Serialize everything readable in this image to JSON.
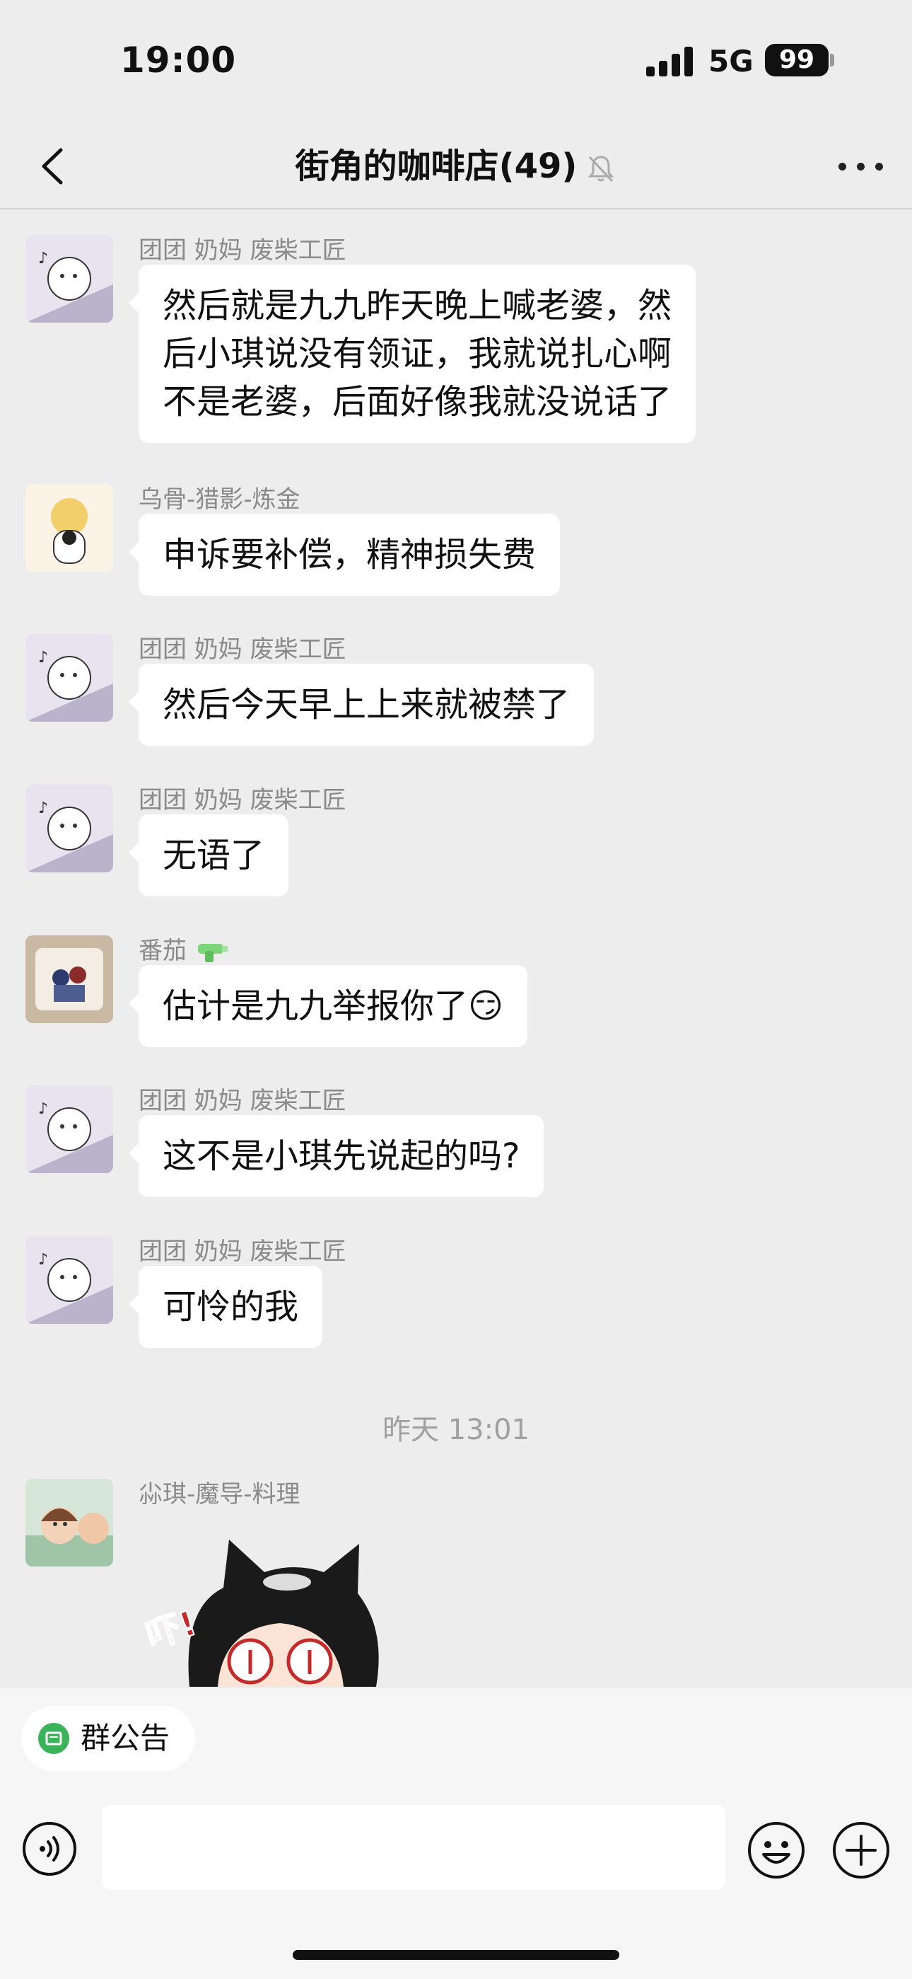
{
  "status_bar": {
    "time": "19:00",
    "network": "5G",
    "battery": "99"
  },
  "nav": {
    "title": "街角的咖啡店(49)"
  },
  "messages": [
    {
      "sender": "团团  奶妈 废柴工匠",
      "lines": [
        "然后就是九九昨天晚上喊老婆，然",
        "后小琪说没有领证，我就说扎心啊",
        "不是老婆，后面好像我就没说话了"
      ]
    },
    {
      "sender": "乌骨-猎影-炼金",
      "text": "申诉要补偿，精神损失费"
    },
    {
      "sender": "团团  奶妈 废柴工匠",
      "text": "然后今天早上上来就被禁了"
    },
    {
      "sender": "团团  奶妈 废柴工匠",
      "text": "无语了"
    },
    {
      "sender": "番茄",
      "text": "估计是九九举报你了",
      "emoji": "😏"
    },
    {
      "sender": "团团  奶妈 废柴工匠",
      "text": "这不是小琪先说起的吗?"
    },
    {
      "sender": "团团  奶妈 废柴工匠",
      "text": "可怜的我"
    }
  ],
  "timestamp": "昨天 13:01",
  "last_message": {
    "sender": "尛琪-魔导-料理",
    "sticker_text": "吓!"
  },
  "bottom": {
    "notice_label": "群公告"
  },
  "icons": {
    "back": "chevron-left-icon",
    "mute": "bell-off-icon",
    "more": "more-dots-icon",
    "voice": "voice-icon",
    "emoji": "emoji-icon",
    "plus": "plus-icon",
    "notice": "announcement-icon"
  },
  "colors": {
    "background": "#ededed",
    "bubble": "#ffffff",
    "sender": "#8a8a8a",
    "notice_icon": "#3bb35b"
  }
}
